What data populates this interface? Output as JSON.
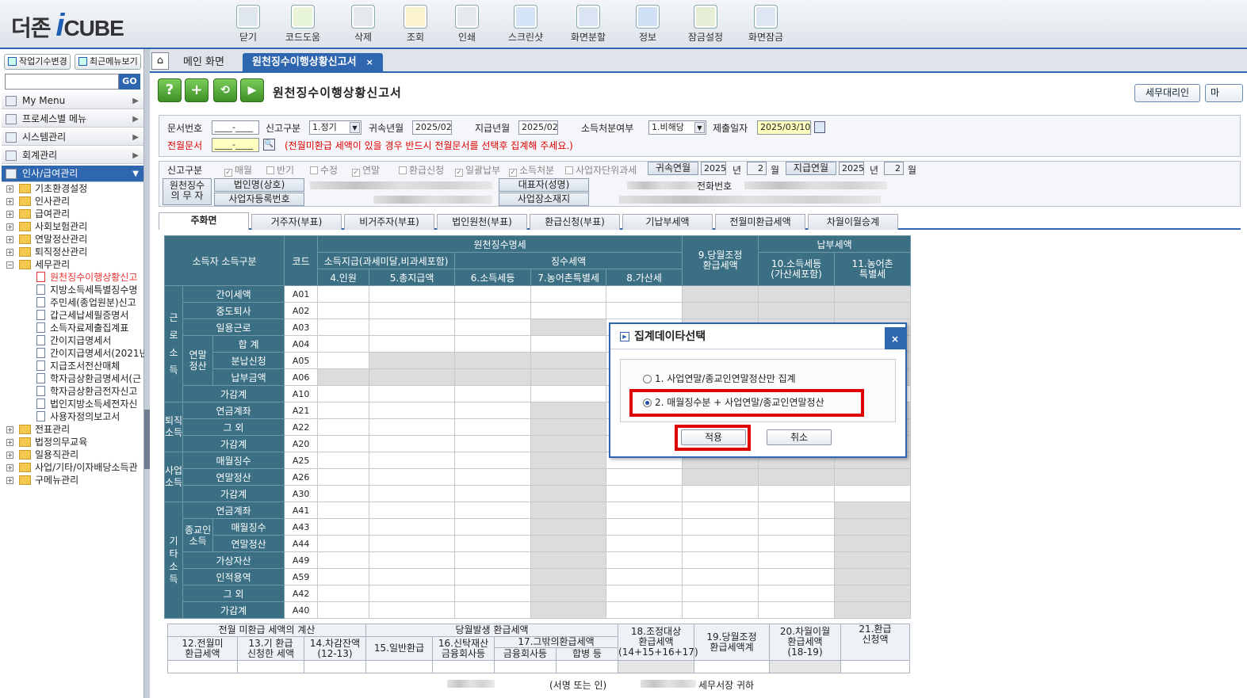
{
  "app": {
    "logo_prefix": "더존",
    "logo_i": "i",
    "logo_suffix": "CUBE"
  },
  "toolbar": [
    {
      "label": "닫기",
      "icon": "close-window-icon"
    },
    {
      "label": "코드도움",
      "icon": "code-help-icon"
    },
    {
      "label": "삭제",
      "icon": "delete-icon"
    },
    {
      "label": "조회",
      "icon": "search-icon"
    },
    {
      "label": "인쇄",
      "icon": "print-icon"
    },
    {
      "label": "스크린샷",
      "icon": "screenshot-icon"
    },
    {
      "label": "화면분할",
      "icon": "split-screen-icon"
    },
    {
      "label": "정보",
      "icon": "info-icon"
    },
    {
      "label": "잠금설정",
      "icon": "lock-settings-icon"
    },
    {
      "label": "화면잠금",
      "icon": "screen-lock-icon"
    }
  ],
  "left": {
    "btn_company": "작업기수변경",
    "btn_recent": "최근메뉴보기",
    "search_placeholder": "",
    "go": "GO",
    "menus": [
      "My Menu",
      "프로세스별 메뉴",
      "시스템관리",
      "회계관리",
      "인사/급여관리"
    ],
    "tree": {
      "top": [
        "기초환경설정",
        "인사관리",
        "급여관리",
        "사회보험관리",
        "연말정산관리",
        "퇴직정산관리",
        "세무관리"
      ],
      "tax_children": [
        "원천징수이행상황신고",
        "지방소득세특별징수명",
        "주민세(종업원분)신고",
        "갑근세납세필증명서",
        "소득자료제출집계표",
        "간이지급명세서",
        "간이지급명세서(2021년",
        "지급조서전산매체",
        "학자금상환금명세서(근",
        "학자금상환금전자신고",
        "법인지방소득세전자신",
        "사용자정의보고서"
      ],
      "bottom": [
        "전표관리",
        "법정의무교육",
        "일용직관리",
        "사업/기타/이자배당소득관",
        "구메뉴관리"
      ]
    }
  },
  "tabs": {
    "main": "메인 화면",
    "active": "원천징수이행상황신고서",
    "close": "×"
  },
  "form": {
    "title": "원천징수이행상황신고서",
    "right_btn1": "세무대리인",
    "right_btn2": "마",
    "row1": {
      "doc_no_label": "문서번호",
      "doc_no_value": "____-____",
      "report_type_label": "신고구분",
      "report_type_value": "1.정기",
      "belong_label": "귀속년월",
      "belong_value": "2025/02",
      "pay_label": "지급년월",
      "pay_value": "2025/02",
      "dispose_label": "소득처분여부",
      "dispose_value": "1.비해당",
      "submit_label": "제출일자",
      "submit_value": "2025/03/10"
    },
    "row2": {
      "prev_doc_label": "전월문서",
      "prev_doc_value": "____-____",
      "notice": "(전월미환급 세액이 있을 경우 반드시 전월문서를 선택후 집계해 주세요.)"
    },
    "report_flags": {
      "label": "신고구분",
      "items": [
        {
          "text": "매월",
          "checked": true
        },
        {
          "text": "반기",
          "checked": false
        },
        {
          "text": "수정",
          "checked": false
        },
        {
          "text": "연말",
          "checked": true
        },
        {
          "text": "환급신청",
          "checked": false
        },
        {
          "text": "일괄납부",
          "checked": true
        },
        {
          "text": "소득처분",
          "checked": true
        },
        {
          "text": "사업자단위과세",
          "checked": false
        }
      ],
      "belong_label": "귀속연월",
      "belong_year": "2025",
      "year_unit": "년",
      "belong_month": "2",
      "month_unit": "월",
      "pay_label": "지급연월",
      "pay_year": "2025",
      "pay_month": "2"
    },
    "agent": {
      "label": "원천징수\n의 무 자",
      "corp_name_label": "법인명(상호)",
      "rep_label": "대표자(성명)",
      "phone_label": "전화번호",
      "biz_no_label": "사업자등록번호",
      "address_label": "사업장소재지"
    },
    "subtabs": [
      "주화면",
      "거주자(부표)",
      "비거주자(부표)",
      "법인원천(부표)",
      "환급신청(부표)",
      "기납부세액",
      "전월미환급세액",
      "차월이월승계"
    ]
  },
  "grid": {
    "h_income": "소득자 소득구분",
    "h_code": "코드",
    "h_withhold": "원천징수명세",
    "h_payment": "소득지급(과세미달,비과세포함)",
    "h_tax": "징수세액",
    "h_c4": "4.인원",
    "h_c5": "5.총지급액",
    "h_c6": "6.소득세등",
    "h_c7": "7.농어촌특별세",
    "h_c8": "8.가산세",
    "h_c9": "9.당월조정\n환급세액",
    "h_pay": "납부세액",
    "h_c10": "10.소득세등\n(가산세포함)",
    "h_c11": "11.농어촌\n특별세",
    "groups": {
      "labor": "근\n로\n소\n득",
      "year_end": "연말\n정산",
      "retire": "퇴직\n소득",
      "business": "사업\n소득",
      "other": "기\n타\n소\n득",
      "religious": "종교인\n소득"
    },
    "rows": [
      {
        "label": "간이세액",
        "code": "A01"
      },
      {
        "label": "중도퇴사",
        "code": "A02"
      },
      {
        "label": "일용근로",
        "code": "A03"
      },
      {
        "label": "합   계",
        "code": "A04"
      },
      {
        "label": "분납신청",
        "code": "A05"
      },
      {
        "label": "납부금액",
        "code": "A06"
      },
      {
        "label": "가감계",
        "code": "A10"
      },
      {
        "label": "연금계좌",
        "code": "A21"
      },
      {
        "label": "그  외",
        "code": "A22"
      },
      {
        "label": "가감계",
        "code": "A20"
      },
      {
        "label": "매월징수",
        "code": "A25"
      },
      {
        "label": "연말정산",
        "code": "A26"
      },
      {
        "label": "가감계",
        "code": "A30"
      },
      {
        "label": "연금계좌",
        "code": "A41"
      },
      {
        "label": "매월징수",
        "code": "A43"
      },
      {
        "label": "연말정산",
        "code": "A44"
      },
      {
        "label": "가상자산",
        "code": "A49"
      },
      {
        "label": "인적용역",
        "code": "A59"
      },
      {
        "label": "그  외",
        "code": "A42"
      },
      {
        "label": "가감계",
        "code": "A40"
      }
    ]
  },
  "bottom": {
    "h_prev": "전월 미환급 세액의 계산",
    "h_curr": "당월발생 환급세액",
    "c12": "12.전월미\n환급세액",
    "c13": "13.기 환급\n신청한 세액",
    "c14": "14.차감잔액\n(12-13)",
    "c15": "15.일반환급",
    "c16": "16.신탁재산\n금융회사등",
    "c17": "17.그밖의환급세액",
    "c17a": "금융회사등",
    "c17b": "합병 등",
    "c18": "18.조정대상\n환급세액\n(14+15+16+17)",
    "c19": "19.당월조정\n환급세액계",
    "c20": "20.차월이월\n환급세액\n(18-19)",
    "c21": "21.환급\n신청액",
    "sign": "(서명 또는 인)",
    "office": "세무서장 귀하"
  },
  "dialog": {
    "title": "집계데이타선택",
    "option1": "1. 사업연말/종교인연말정산만 집계",
    "option2": "2. 매월징수분 + 사업연말/종교인연말정산",
    "selected": 2,
    "ok": "적용",
    "cancel": "취소"
  }
}
